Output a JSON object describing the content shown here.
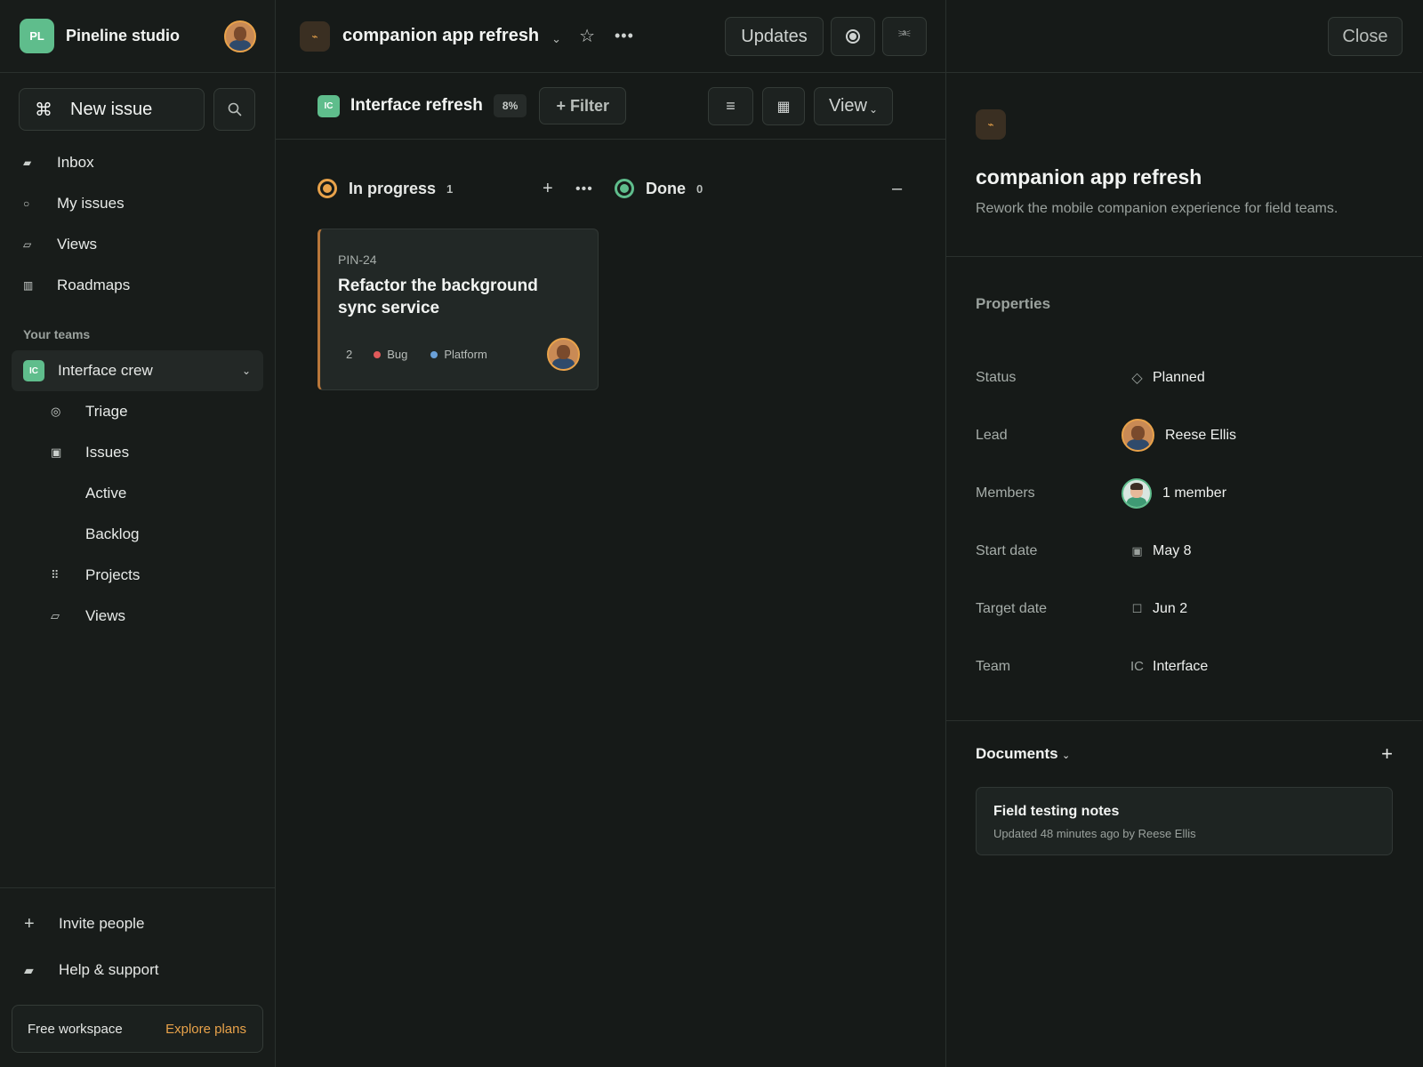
{
  "workspace": {
    "initials": "PL",
    "name": "Pineline studio"
  },
  "sidebar": {
    "new_issue_label": "New issue",
    "nav": [
      {
        "label": "Inbox",
        "icon": "inbox-icon"
      },
      {
        "label": "My issues",
        "icon": "circle-icon"
      },
      {
        "label": "Views",
        "icon": "views-icon"
      },
      {
        "label": "Roadmaps",
        "icon": "roadmap-icon"
      }
    ],
    "teams_label": "Your teams",
    "team": {
      "initials": "IC",
      "name": "Interface crew"
    },
    "team_items": [
      "Triage",
      "Issues",
      "Active",
      "Backlog",
      "Projects",
      "Views"
    ],
    "invite_label": "Invite people",
    "help_label": "Help & support",
    "plan_label": "Free workspace",
    "explore_label": "Explore plans"
  },
  "project": {
    "title": "companion app refresh",
    "updates_label": "Updates"
  },
  "subbar": {
    "team_initials": "IC",
    "title": "Interface refresh",
    "progress": "8%",
    "filter_label": "+ Filter",
    "view_label": "View"
  },
  "board": {
    "columns": [
      {
        "name": "In progress",
        "count": "1"
      },
      {
        "name": "Done",
        "count": "0"
      }
    ],
    "card": {
      "id": "PIN-24",
      "title": "Refactor the background sync service",
      "priority": "2",
      "labels": [
        {
          "name": "Bug",
          "color": "#e05a5a"
        },
        {
          "name": "Platform",
          "color": "#6aa0d8"
        }
      ]
    }
  },
  "panel": {
    "close_label": "Close",
    "title": "companion app refresh",
    "description": "Rework the mobile companion experience for field teams.",
    "properties_title": "Properties",
    "properties": [
      {
        "label": "Status",
        "value": "Planned"
      },
      {
        "label": "Lead",
        "value": "Reese Ellis"
      },
      {
        "label": "Members",
        "value": "1 member"
      },
      {
        "label": "Start date",
        "value": "May 8"
      },
      {
        "label": "Target date",
        "value": "Jun 2"
      },
      {
        "label": "Team",
        "value": "Interface",
        "badge": "IC"
      }
    ],
    "documents_title": "Documents",
    "documents": [
      {
        "title": "Field testing notes",
        "meta": "Updated 48 minutes ago by Reese Ellis"
      }
    ]
  },
  "colors": {
    "accent": "#e8a24a",
    "brand": "#5fbd8c",
    "background": "#161a18"
  }
}
